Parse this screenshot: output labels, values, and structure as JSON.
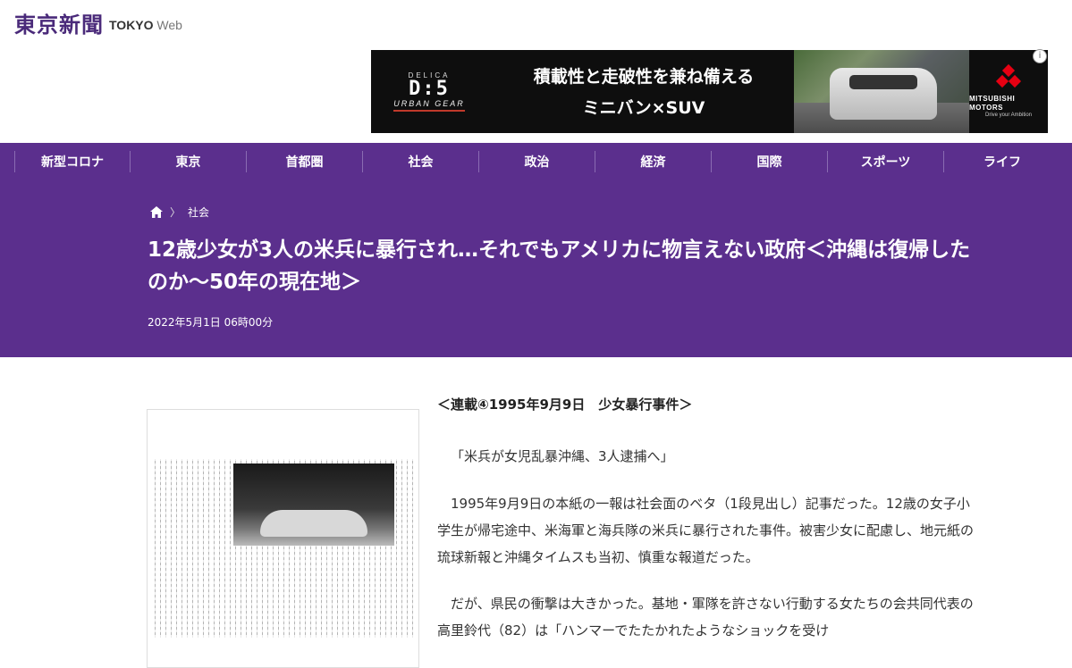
{
  "header": {
    "logo_text": "東京新聞",
    "logo_sub_bold": "TOKYO",
    "logo_sub_light": "Web"
  },
  "ad": {
    "brand_small": "DELICA",
    "model": "D:5",
    "edition": "URBAN GEAR",
    "headline": "積載性と走破性を兼ね備える",
    "subline": "ミニバン×SUV",
    "maker": "MITSUBISHI MOTORS",
    "slogan": "Drive your Ambition",
    "info_glyph": "i"
  },
  "nav": {
    "items": [
      "新型コロナ",
      "東京",
      "首都圏",
      "社会",
      "政治",
      "経済",
      "国際",
      "スポーツ",
      "ライフ"
    ]
  },
  "breadcrumb": {
    "home_icon": "home-icon",
    "separator": "〉",
    "category": "社会"
  },
  "article": {
    "title": "12歳少女が3人の米兵に暴行され…それでもアメリカに物言えない政府＜沖縄は復帰したのか～50年の現在地＞",
    "date": "2022年5月1日 06時00分",
    "subhead": "＜連載④1995年9月9日　少女暴行事件＞",
    "paragraphs": [
      "「米兵が女児乱暴沖縄、3人逮捕へ」",
      "1995年9月9日の本紙の一報は社会面のベタ（1段見出し）記事だった。12歳の女子小学生が帰宅途中、米海軍と海兵隊の米兵に暴行された事件。被害少女に配慮し、地元紙の琉球新報と沖縄タイムスも当初、慎重な報道だった。",
      "だが、県民の衝撃は大きかった。基地・軍隊を許さない行動する女たちの会共同代表の高里鈴代（82）は「ハンマーでたたかれたようなショックを受け"
    ]
  },
  "colors": {
    "brand_purple": "#5b2f8d",
    "logo_purple": "#4a2a7a",
    "ad_red": "#e60012"
  }
}
